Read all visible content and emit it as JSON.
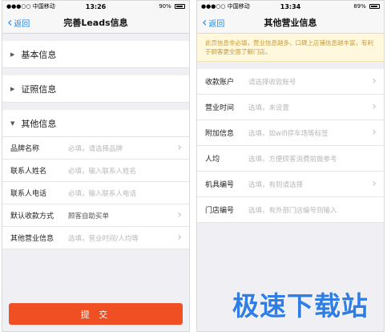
{
  "left_screen": {
    "status": {
      "carrier": "●●●○○ 中国移动 ",
      "time": "13:26",
      "battery": "90%",
      "battery_level": 0.9
    },
    "nav": {
      "back": "返回",
      "title": "完善Leads信息"
    },
    "sections": [
      {
        "label": "基本信息"
      },
      {
        "label": "证照信息"
      },
      {
        "label": "其他信息"
      }
    ],
    "fields": [
      {
        "label": "品牌名称",
        "value": "必填，请选择品牌",
        "arrow": true
      },
      {
        "label": "联系人姓名",
        "value": "必填，输入联系人姓名",
        "arrow": false
      },
      {
        "label": "联系人电话",
        "value": "必填，输入联系人电话",
        "arrow": false
      },
      {
        "label": "默认收款方式",
        "value": "顾客自助买单",
        "arrow": true
      },
      {
        "label": "其他营业信息",
        "value": "选填，营业时间/人均等",
        "arrow": true
      }
    ],
    "submit": "提 交"
  },
  "right_screen": {
    "status": {
      "carrier": "●●●○○ 中国移动 ",
      "time": "13:34",
      "battery": "89%",
      "battery_level": 0.89
    },
    "nav": {
      "back": "返回",
      "title": "其他营业信息"
    },
    "notice": "此页信息非必填，营业信息越多，口碑上店铺信息越丰富，有利于顾客更全面了解门店。",
    "fields": [
      {
        "label": "收款账户",
        "value": "请选择收款账号",
        "arrow": true
      },
      {
        "label": "营业时间",
        "value": "选填，未设置",
        "arrow": true
      },
      {
        "label": "附加信息",
        "value": "选填，如wifi停车场等标签",
        "arrow": true
      },
      {
        "label": "人均",
        "value": "选填，方便顾客消费前做参考",
        "arrow": false
      },
      {
        "label": "机具编号",
        "value": "选填，有则请选择",
        "arrow": true
      },
      {
        "label": "门店编号",
        "value": "选填，有外部门店编号则输入",
        "arrow": false
      }
    ]
  },
  "watermark": "极速下载站",
  "colors": {
    "accent_blue": "#1a8bf0",
    "submit_red": "#f04e23",
    "notice_bg": "#fff8dc",
    "watermark_blue": "#2f7ee6"
  }
}
